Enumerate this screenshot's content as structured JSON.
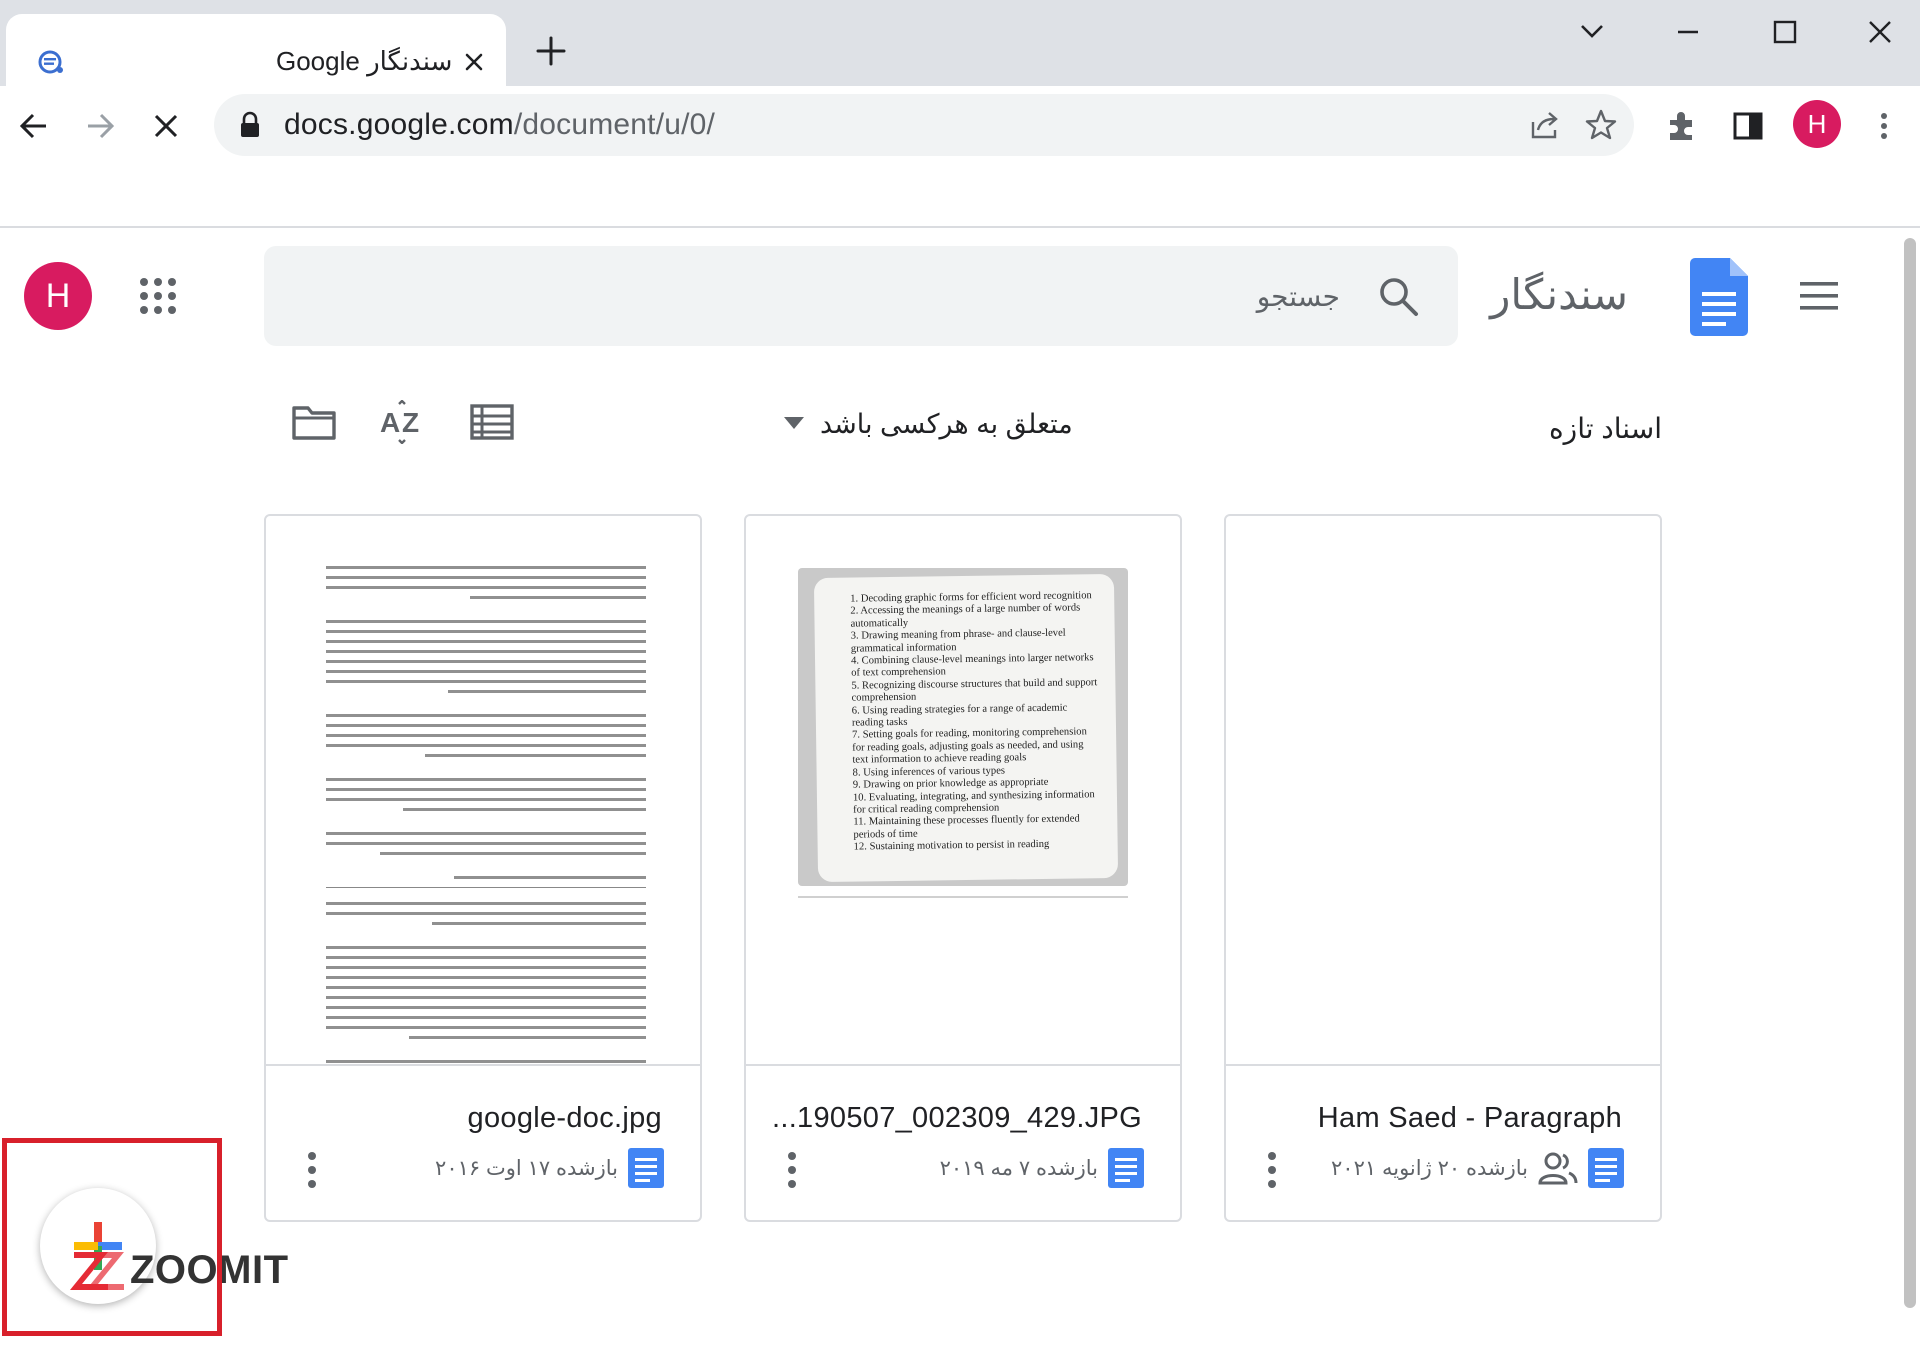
{
  "browser": {
    "tab_title": "سندنگار Google",
    "url_host": "docs.google.com",
    "url_path": "/document/u/0/",
    "profile_initial": "H"
  },
  "app": {
    "name": "سندنگار",
    "search_placeholder": "جستجو",
    "avatar_initial": "H",
    "accent_color": "#4285f4",
    "avatar_color": "#d81b60"
  },
  "list": {
    "section_title": "اسناد تازه",
    "owner_filter": "متعلق به هرکسی باشد"
  },
  "documents": [
    {
      "title": "google-doc.jpg",
      "date": "بازشده ۱۷ اوت ۲۰۱۶",
      "shared": false,
      "thumb": "text-page"
    },
    {
      "title": "...190507_002309_429.JPG",
      "date": "بازشده ۷ مه ۲۰۱۹",
      "shared": false,
      "thumb": "photo"
    },
    {
      "title": "Ham Saed - Paragraph",
      "date": "بازشده ۲۰ ژانویه ۲۰۲۱",
      "shared": true,
      "thumb": "blank"
    }
  ],
  "photo_list": [
    "1. Decoding graphic forms for efficient word recognition",
    "2. Accessing the meanings of a large number of words automatically",
    "3. Drawing meaning from phrase- and clause-level grammatical information",
    "4. Combining clause-level meanings into larger networks of text comprehension",
    "5. Recognizing discourse structures that build and support comprehension",
    "6. Using reading strategies for a range of academic reading tasks",
    "7. Setting goals for reading, monitoring comprehension for reading goals, adjusting goals as needed, and using text information to achieve reading goals",
    "8. Using inferences of various types",
    "9. Drawing on prior knowledge as appropriate",
    "10. Evaluating, integrating, and synthesizing information for critical reading comprehension",
    "11. Maintaining these processes fluently for extended periods of time",
    "12. Sustaining motivation to persist in reading"
  ],
  "watermark": {
    "text": "ZOOMIT",
    "highlight_color": "#d8202b"
  }
}
